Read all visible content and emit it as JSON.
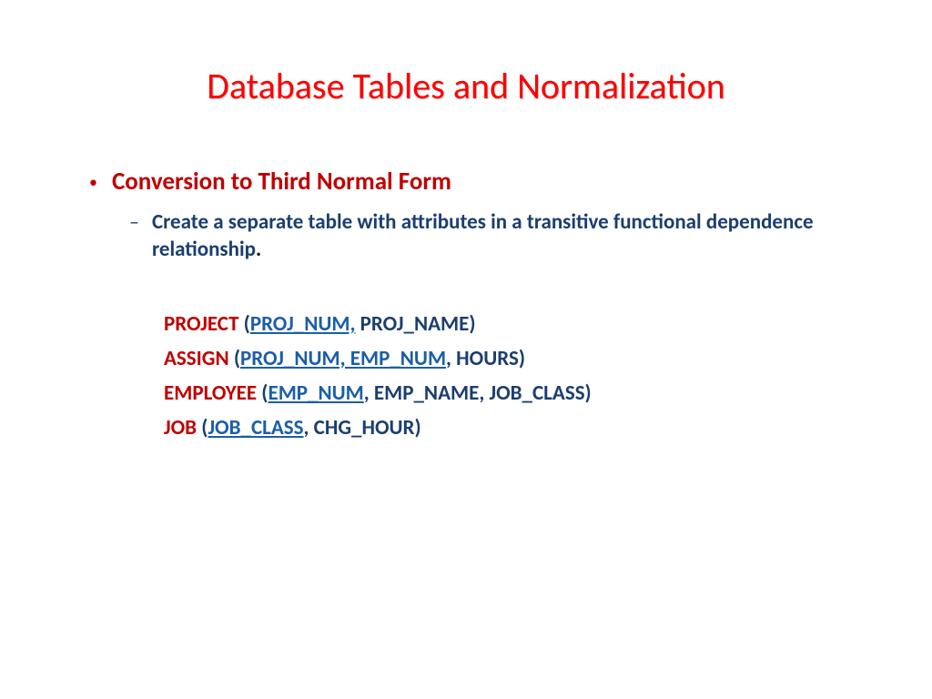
{
  "title": "Database Tables and Normalization",
  "bullet": "Conversion to Third Normal Form",
  "sub_bullet": "Create a separate table with attributes in a transitive functional dependence relationship",
  "tables": [
    {
      "name": "PROJECT",
      "keys": "PROJ_NUM,",
      "rest": " PROJ_NAME)"
    },
    {
      "name": "ASSIGN",
      "keys": "PROJ_NUM, EMP_NUM",
      "rest": ", HOURS)"
    },
    {
      "name": "EMPLOYEE",
      "keys": "EMP_NUM",
      "rest": ", EMP_NAME, JOB_CLASS)"
    },
    {
      "name": "JOB",
      "keys": "JOB_CLASS",
      "rest": ", CHG_HOUR)"
    }
  ]
}
